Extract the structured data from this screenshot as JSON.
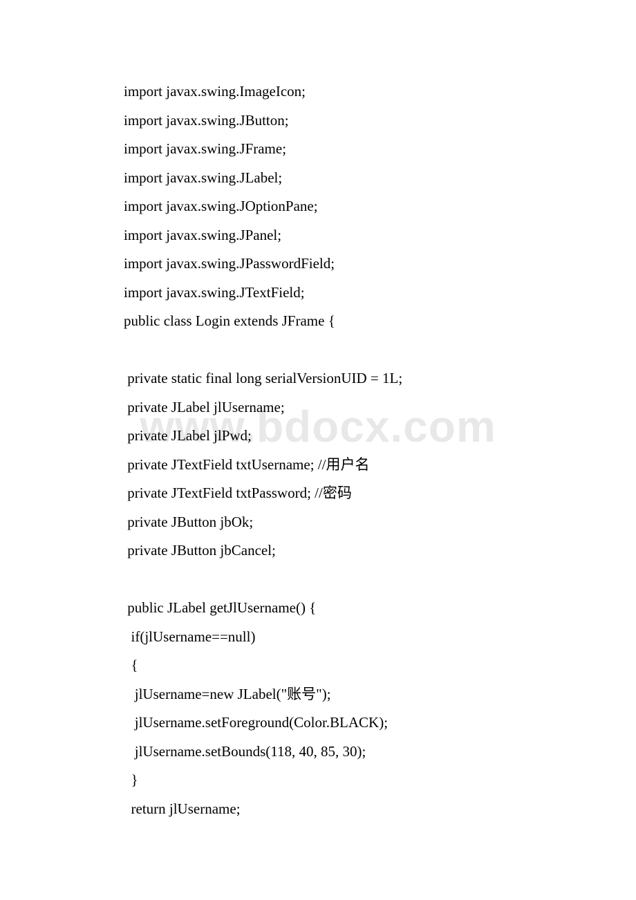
{
  "watermark": "www.bdocx.com",
  "code": {
    "lines": [
      "import javax.swing.ImageIcon;",
      "import javax.swing.JButton;",
      "import javax.swing.JFrame;",
      "import javax.swing.JLabel;",
      "import javax.swing.JOptionPane;",
      "import javax.swing.JPanel;",
      "import javax.swing.JPasswordField;",
      "import javax.swing.JTextField;",
      "public class Login extends JFrame {",
      "",
      " private static final long serialVersionUID = 1L;",
      " private JLabel jlUsername;",
      " private JLabel jlPwd;",
      " private JTextField txtUsername; //用户名",
      " private JTextField txtPassword; //密码",
      " private JButton jbOk;",
      " private JButton jbCancel;",
      "",
      " public JLabel getJlUsername() {",
      "  if(jlUsername==null)",
      "  {",
      "   jlUsername=new JLabel(\"账号\");",
      "   jlUsername.setForeground(Color.BLACK);",
      "   jlUsername.setBounds(118, 40, 85, 30);",
      "  }",
      "  return jlUsername;"
    ]
  }
}
